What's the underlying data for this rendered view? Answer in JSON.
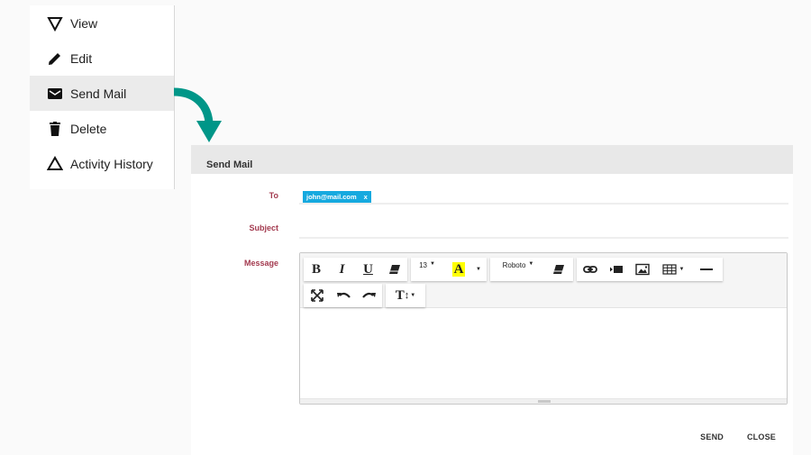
{
  "menu": {
    "items": [
      {
        "label": "View",
        "icon": "view-triangle-down-icon"
      },
      {
        "label": "Edit",
        "icon": "pencil-icon"
      },
      {
        "label": "Send Mail",
        "icon": "envelope-icon",
        "active": true
      },
      {
        "label": "Delete",
        "icon": "trash-icon"
      },
      {
        "label": "Activity History",
        "icon": "triangle-up-icon"
      }
    ]
  },
  "colors": {
    "arrow": "#009688",
    "label": "#a33a4f",
    "chip": "#16a9df",
    "highlight": "#ffff00"
  },
  "dialog": {
    "title": "Send Mail",
    "to_label": "To",
    "to_chip": "john@mail.com",
    "to_chip_remove": "x",
    "subject_label": "Subject",
    "subject_value": "",
    "message_label": "Message",
    "message_value": "",
    "toolbar": {
      "bold": "B",
      "italic": "I",
      "underline": "U",
      "font_size": "13",
      "font_color_glyph": "A",
      "font_family": "Roboto",
      "text_height_glyph": "T"
    },
    "send_label": "SEND",
    "close_label": "CLOSE"
  }
}
